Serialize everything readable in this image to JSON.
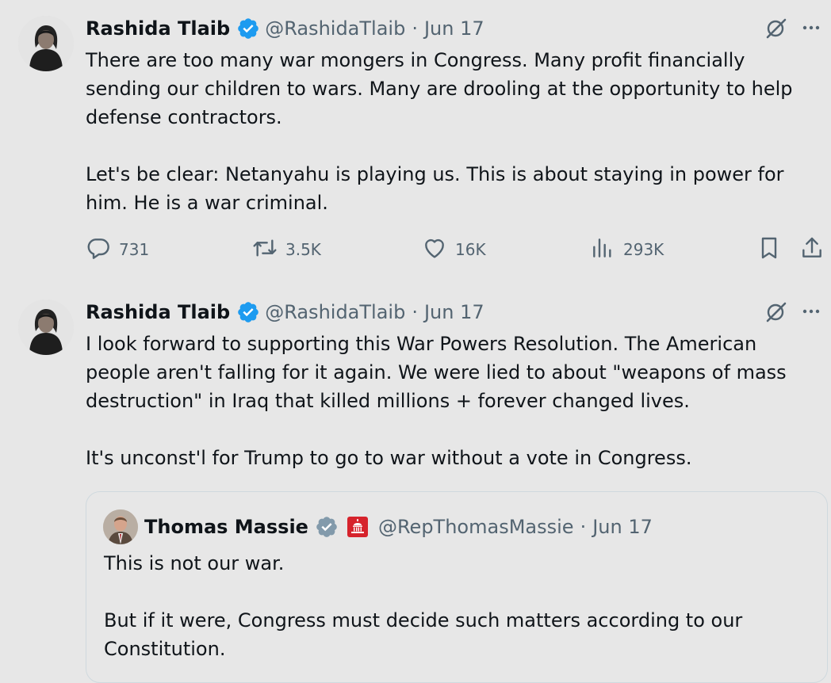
{
  "tweets": [
    {
      "author": "Rashida Tlaib",
      "handle": "@RashidaTlaib",
      "separator": "·",
      "date": "Jun 17",
      "paragraph1": "There are too many war mongers in Congress. Many profit financially sending our children to wars. Many are drooling at the opportunity to help defense contractors.",
      "paragraph2": "Let's be clear: Netanyahu is playing us. This is about staying in power for him. He is a war criminal.",
      "replies": "731",
      "reposts": "3.5K",
      "likes": "16K",
      "views": "293K"
    },
    {
      "author": "Rashida Tlaib",
      "handle": "@RashidaTlaib",
      "separator": "·",
      "date": "Jun 17",
      "paragraph1": "I look forward to supporting this War Powers Resolution. The American people aren't falling for it again. We were lied to about \"weapons of mass destruction\" in Iraq that killed millions + forever changed lives.",
      "paragraph2": "It's unconst'l for Trump to go to war without a vote in Congress."
    }
  ],
  "quote": {
    "author": "Thomas Massie",
    "handle": "@RepThomasMassie",
    "separator": "·",
    "date": "Jun 17",
    "paragraph1": "This is not our war.",
    "paragraph2": "But if it were, Congress must decide such matters according to our Constitution."
  },
  "icons": {
    "verified": "verified-badge-icon",
    "grok": "grok-icon",
    "more": "more-icon",
    "reply": "reply-icon",
    "repost": "repost-icon",
    "like": "like-icon",
    "views": "views-icon",
    "bookmark": "bookmark-icon",
    "share": "share-icon",
    "capitol": "us-capitol-icon"
  },
  "colors": {
    "verified_blue": "#1d9bf0",
    "gov_badge_gray": "#829aab",
    "capitol_red": "#d6232c"
  }
}
